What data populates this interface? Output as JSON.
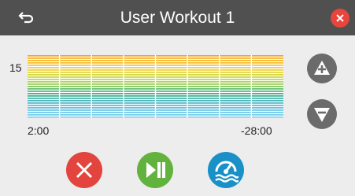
{
  "header": {
    "title": "User Workout 1",
    "back_icon": "back-arrow-icon",
    "close_icon": "close-icon"
  },
  "chart": {
    "level_label": "15",
    "time_start": "2:00",
    "time_end": "-28:00",
    "segments": 8,
    "level": 15,
    "gradient_colors": [
      "#f5a623",
      "#f7d23a",
      "#b7d84a",
      "#3fb08a",
      "#56bfe0",
      "#8ad4f2"
    ]
  },
  "side_buttons": {
    "increase_icon": "plus-icon",
    "decrease_icon": "minus-icon"
  },
  "controls": {
    "stop_icon": "stop-x-icon",
    "play_pause_icon": "play-pause-icon",
    "water_icon": "water-speed-icon"
  },
  "colors": {
    "titlebar": "#505050",
    "close": "#e8453c",
    "stop": "#e3443d",
    "play": "#62b23e",
    "water": "#1990c7",
    "side_buttons": "#6b6b6b"
  }
}
